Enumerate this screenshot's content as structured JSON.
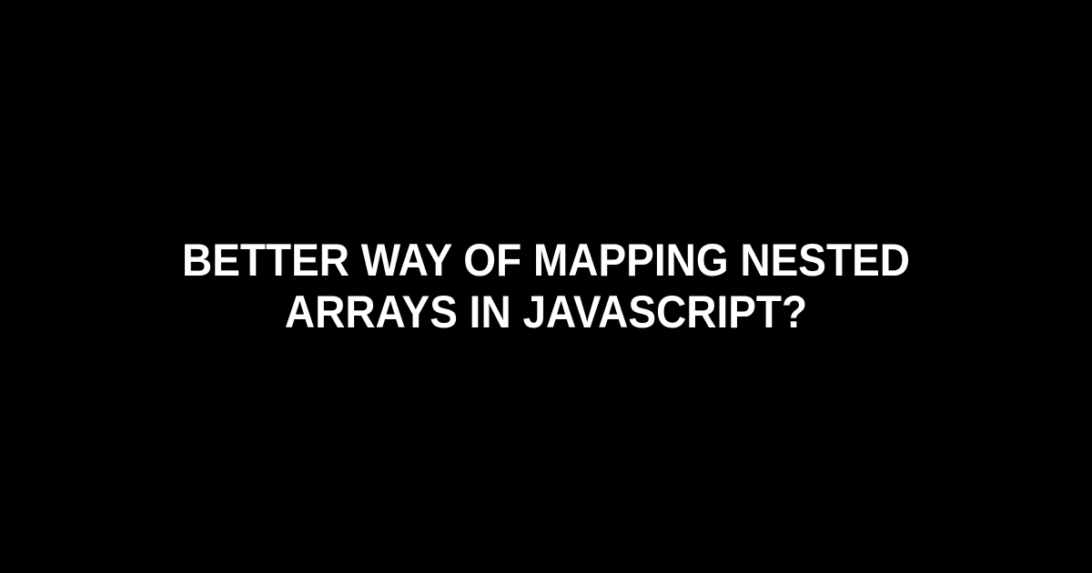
{
  "main": {
    "title": "Better Way of Mapping Nested Arrays in JavaScript?"
  }
}
